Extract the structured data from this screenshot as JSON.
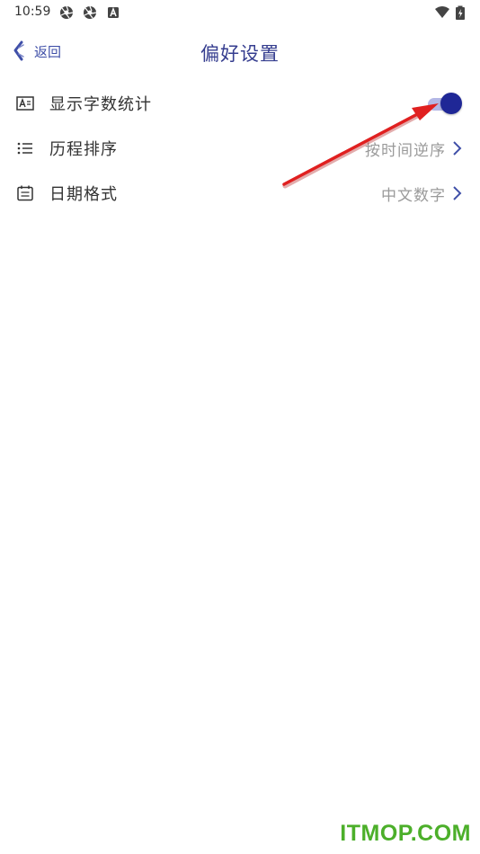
{
  "status_bar": {
    "time": "10:59",
    "icons": [
      "shutter-icon",
      "shutter-icon",
      "a-letter-icon",
      "wifi-icon",
      "battery-charging-icon"
    ]
  },
  "header": {
    "back_label": "返回",
    "title": "偏好设置"
  },
  "settings": [
    {
      "icon": "text-count-icon",
      "label": "显示字数统计",
      "control": "toggle",
      "toggle_on": true
    },
    {
      "icon": "list-icon",
      "label": "历程排序",
      "control": "value",
      "value": "按时间逆序"
    },
    {
      "icon": "calendar-icon",
      "label": "日期格式",
      "control": "value",
      "value": "中文数字"
    }
  ],
  "watermark": "ITMOP.COM",
  "colors": {
    "accent": "#1f2796",
    "title": "#353d8f",
    "toggle_track": "#b3b7e6",
    "arrow": "#e02020",
    "watermark": "#4caf2a"
  }
}
